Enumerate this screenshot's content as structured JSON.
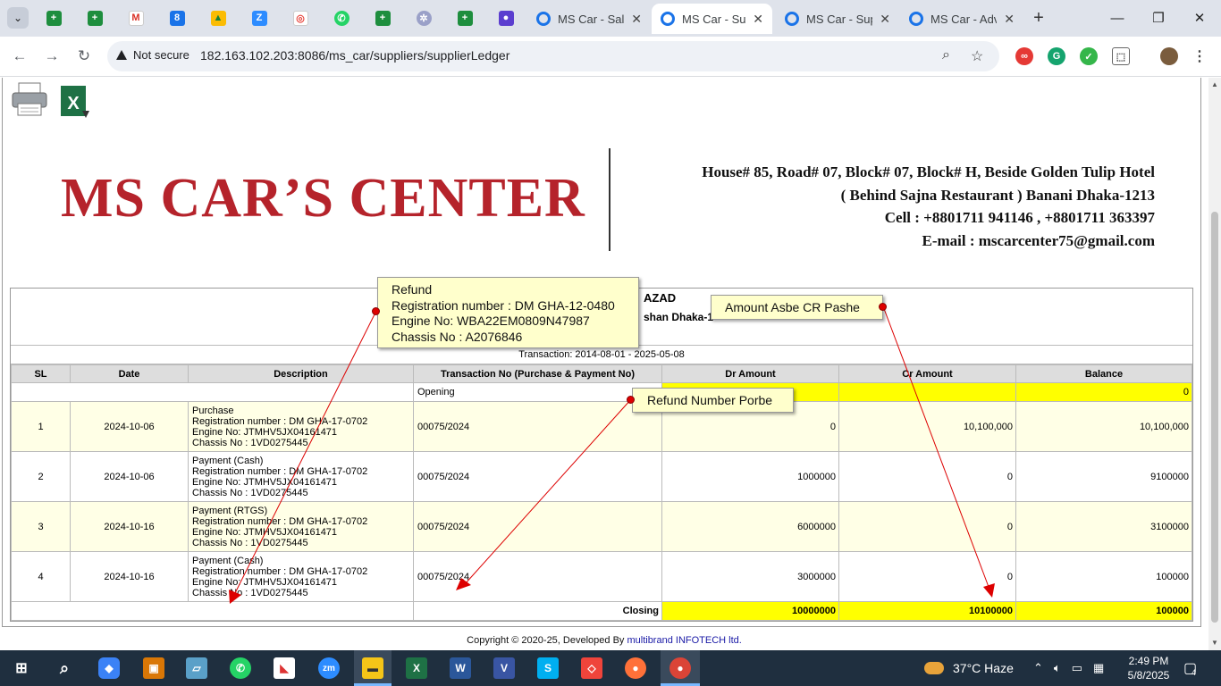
{
  "browser": {
    "tabs": [
      {
        "title": "MS Car - Sale",
        "active": false
      },
      {
        "title": "MS Car - Sup",
        "active": true
      },
      {
        "title": "MS Car - Sup",
        "active": false
      },
      {
        "title": "MS Car - Adv",
        "active": false
      }
    ],
    "new_tab": "+",
    "security_label": "Not secure",
    "url": "182.163.102.203:8086/ms_car/suppliers/supplierLedger",
    "pinned_icons": [
      "sheets-icon",
      "sheets-icon",
      "gmail-icon",
      "calendar-icon",
      "drive-icon",
      "zoom-icon",
      "app-icon",
      "whatsapp-icon",
      "sheets-icon",
      "settings-app-icon",
      "sheets-icon",
      "podcast-icon"
    ],
    "extensions": [
      "pdf-extension-icon",
      "grammarly-icon",
      "vpn-extension-icon",
      "extensions-icon",
      "profile-avatar"
    ]
  },
  "page": {
    "company_name": "MS CAR’S CENTER",
    "address_lines": [
      "House# 85, Road# 07, Block# 07, Block# H, Beside Golden Tulip Hotel",
      "( Behind Sajna Restaurant ) Banani Dhaka-1213",
      "Cell : +8801711 941146 , +8801711 363397",
      "E-mail : mscarcenter75@gmail.com"
    ],
    "supplier_name": "AZAD",
    "supplier_location": "shan Dhaka-1",
    "transaction_range": "Transaction: 2014-08-01 - 2025-05-08",
    "columns": [
      "SL",
      "Date",
      "Description",
      "Transaction No (Purchase & Payment No)",
      "Dr Amount",
      "Cr Amount",
      "Balance"
    ],
    "opening": {
      "label": "Opening",
      "balance": "0"
    },
    "rows": [
      {
        "sl": "1",
        "date": "2024-10-06",
        "desc": [
          "Purchase",
          "Registration number : DM GHA-17-0702",
          "Engine No: JTMHV5JX04161471",
          "Chassis No : 1VD0275445"
        ],
        "txn": "00075/2024",
        "dr": "0",
        "cr": "10,100,000",
        "bal": "10,100,000"
      },
      {
        "sl": "2",
        "date": "2024-10-06",
        "desc": [
          "Payment (Cash)",
          "Registration number : DM GHA-17-0702",
          "Engine No: JTMHV5JX04161471",
          "Chassis No : 1VD0275445"
        ],
        "txn": "00075/2024",
        "dr": "1000000",
        "cr": "0",
        "bal": "9100000"
      },
      {
        "sl": "3",
        "date": "2024-10-16",
        "desc": [
          "Payment (RTGS)",
          "Registration number : DM GHA-17-0702",
          "Engine No: JTMHV5JX04161471",
          "Chassis No : 1VD0275445"
        ],
        "txn": "00075/2024",
        "dr": "6000000",
        "cr": "0",
        "bal": "3100000"
      },
      {
        "sl": "4",
        "date": "2024-10-16",
        "desc": [
          "Payment (Cash)",
          "Registration number : DM GHA-17-0702",
          "Engine No: JTMHV5JX04161471",
          "Chassis No : 1VD0275445"
        ],
        "txn": "00075/2024",
        "dr": "3000000",
        "cr": "0",
        "bal": "100000"
      }
    ],
    "closing": {
      "label": "Closing",
      "dr": "10000000",
      "cr": "10100000",
      "bal": "100000"
    },
    "footer_text": "Copyright © 2020-25, Developed By ",
    "footer_link": "multibrand INFOTECH ltd."
  },
  "annotations": {
    "refund_box": [
      "Refund",
      "Registration number : DM GHA-12-0480",
      "Engine No: WBA22EM0809N47987",
      "Chassis No : A2076846"
    ],
    "refund_number": "Refund Number Porbe",
    "cr_note": "Amount Asbe CR Pashe",
    "arrow_color": "#dd0000"
  },
  "taskbar": {
    "weather": "37°C  Haze",
    "time": "2:49 PM",
    "date": "5/8/2025",
    "notification_count": "4",
    "apps": [
      "start-icon",
      "search-icon",
      "copilot-icon",
      "app-icon",
      "app-icon",
      "whatsapp-icon",
      "app-icon",
      "zoom-icon",
      "file-explorer-icon",
      "excel-icon",
      "word-icon",
      "visio-icon",
      "skype-icon",
      "anydesk-icon",
      "firefox-icon",
      "chrome-icon"
    ]
  }
}
